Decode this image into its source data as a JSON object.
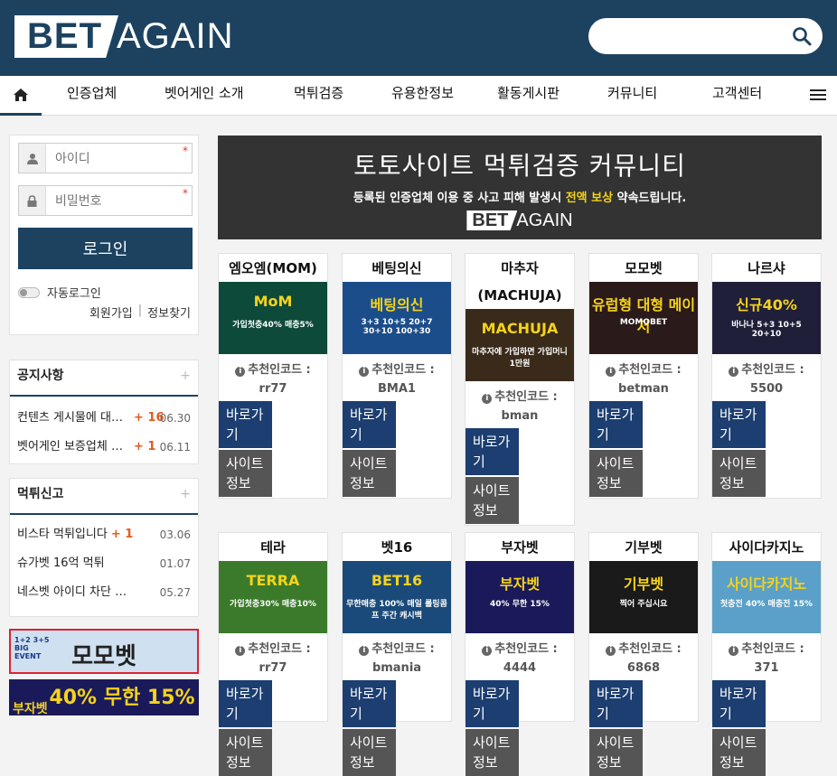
{
  "logo": {
    "bet": "BET",
    "again": "AGAIN"
  },
  "search": {
    "placeholder": ""
  },
  "nav": {
    "items": [
      "인증업체",
      "벳어게인 소개",
      "먹튀검증",
      "유용한정보",
      "활동게시판",
      "커뮤니티",
      "고객센터"
    ]
  },
  "login": {
    "id_placeholder": "아이디",
    "pw_placeholder": "비밀번호",
    "required_mark": "*",
    "button": "로그인",
    "auto_login": "자동로그인",
    "signup": "회원가입",
    "separator": "|",
    "find": "정보찾기"
  },
  "notice": {
    "title": "공지사항",
    "plus": "+",
    "items": [
      {
        "text": "컨텐츠 게시물에 대한 ...",
        "count": "+ 16",
        "date": "06.30"
      },
      {
        "text": "벳어게인 보증업체 입점...",
        "count": "+ 1",
        "date": "06.11"
      }
    ]
  },
  "report": {
    "title": "먹튀신고",
    "plus": "+",
    "items": [
      {
        "text": "비스타 먹튀입니다",
        "count": "+ 1",
        "date": "03.06"
      },
      {
        "text": "슈가벳 16억 먹튀",
        "count": "",
        "date": "01.07"
      },
      {
        "text": "네스벳 아이디 차단 당했습니다",
        "count": "",
        "date": "05.27"
      }
    ]
  },
  "side_banners": [
    {
      "text": "모모벳",
      "sub": "1+2 3+5 BIG EVENT"
    },
    {
      "text": "40% 무한 15%",
      "sub": "부자벳"
    }
  ],
  "hero": {
    "title": "토토사이트 먹튀검증 커뮤니티",
    "sub_before": "등록된 인증업체 이용 중 사고 피해 발생시",
    "sub_highlight": "전액 보상",
    "sub_after": "약속드립니다.",
    "logo_bet": "BET",
    "logo_again": "AGAIN"
  },
  "card_labels": {
    "code_label": "추천인코드 :",
    "go": "바로가기",
    "info": "사이트정보"
  },
  "sites": [
    {
      "name": "엠오엠(MOM)",
      "code": "rr77",
      "banner": "MoM",
      "banner_sub": "가입첫충40% 매충5%",
      "color": "#0e4a3a"
    },
    {
      "name": "베팅의신",
      "code": "BMA1",
      "banner": "베팅의신",
      "banner_sub": "3+3 10+5 20+7 30+10 100+30",
      "color": "#1b4d8a"
    },
    {
      "name": "마추자 (MACHUJA)",
      "code": "bman",
      "banner": "MACHUJA",
      "banner_sub": "마추자에 가입하면 가입머니 1만원",
      "color": "#3a2a1a"
    },
    {
      "name": "모모벳",
      "code": "betman",
      "banner": "유럽형 대형 메이저",
      "banner_sub": "MOMOBET",
      "color": "#2a1a1a"
    },
    {
      "name": "나르샤",
      "code": "5500",
      "banner": "신규40%",
      "banner_sub": "바나나 5+3 10+5 20+10",
      "color": "#1f1f3a"
    },
    {
      "name": "테라",
      "code": "rr77",
      "banner": "TERRA",
      "banner_sub": "가입첫충30% 매충10%",
      "color": "#3a7a2a"
    },
    {
      "name": "벳16",
      "code": "bmania",
      "banner": "BET16",
      "banner_sub": "무한매충 100% 매일 롤링콤프 주간 캐시백",
      "color": "#1a4a7a"
    },
    {
      "name": "부자벳",
      "code": "4444",
      "banner": "부자벳",
      "banner_sub": "40% 무한 15%",
      "color": "#1a1a5a"
    },
    {
      "name": "기부벳",
      "code": "6868",
      "banner": "기부벳",
      "banner_sub": "찍어 주십시요",
      "color": "#1a1a1a"
    },
    {
      "name": "사이다카지노",
      "code": "371",
      "banner": "사이다카지노",
      "banner_sub": "첫충전 40% 매충전 15%",
      "color": "#5aa0c8"
    }
  ]
}
